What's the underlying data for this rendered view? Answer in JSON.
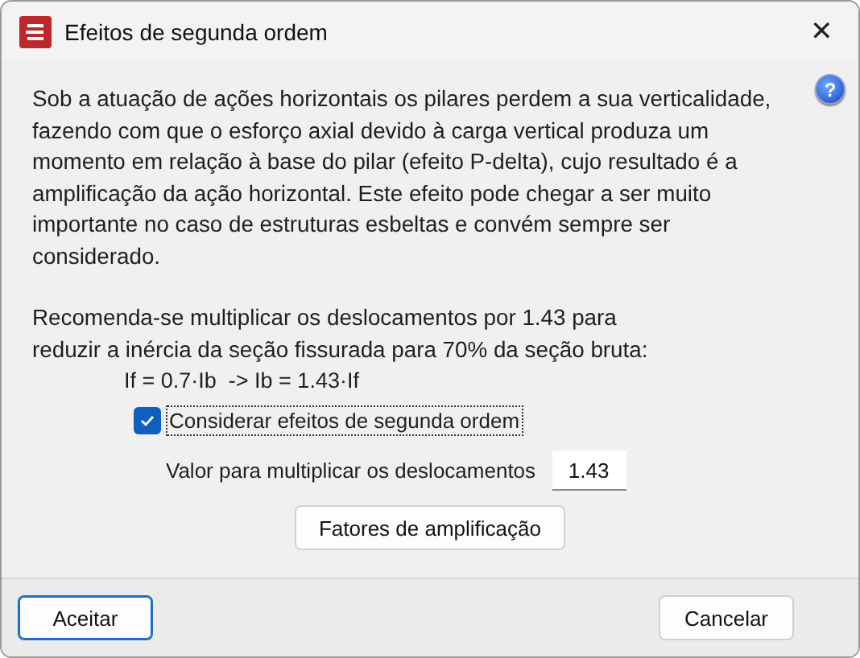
{
  "window": {
    "title": "Efeitos de segunda ordem",
    "close": "✕",
    "help": "?"
  },
  "description": "Sob a atuação de ações horizontais os pilares perdem a sua verticalidade, fazendo com que o esforço axial devido à carga vertical produza um momento em relação à base do pilar (efeito P-delta), cujo resultado é a amplificação da ação horizontal. Este efeito pode chegar a ser muito importante no caso de estruturas esbeltas e convém sempre ser considerado.",
  "recommendation": "Recomenda-se multiplicar os deslocamentos por 1.43 para reduzir a inércia da seção fissurada para 70% da seção bruta:",
  "formula": "If = 0.7·Ib  -> Ib = 1.43·If",
  "option": {
    "label": "Considerar efeitos de segunda ordem",
    "checked": true
  },
  "multiplier": {
    "label": "Valor para multiplicar os deslocamentos",
    "value": "1.43"
  },
  "amplification_button": "Fatores de amplificação",
  "buttons": [
    {
      "label": "Aceitar",
      "default": true
    },
    {
      "label": "Cancelar",
      "default": false
    }
  ]
}
